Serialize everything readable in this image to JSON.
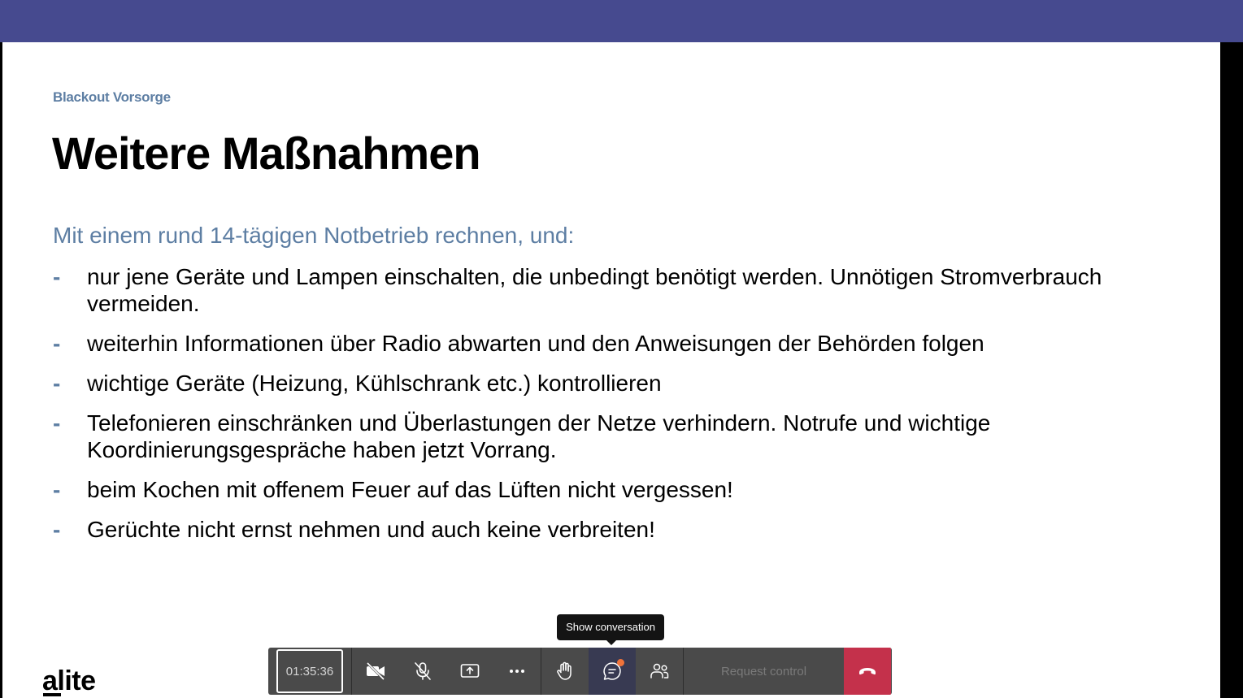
{
  "slide": {
    "kicker": "Blackout Vorsorge",
    "title": "Weitere Maßnahmen",
    "intro": "Mit einem rund 14-tägigen Notbetrieb rechnen, und:",
    "bullet_marker": "-",
    "bullets": [
      "nur jene Geräte und Lampen einschalten, die unbedingt benötigt werden. Unnötigen Stromverbrauch vermeiden.",
      "weiterhin Informationen über Radio abwarten und den Anweisungen der Behörden folgen",
      "wichtige Geräte (Heizung, Kühlschrank etc.) kontrollieren",
      "Telefonieren einschränken und Überlastungen der Netze verhindern. Notrufe und wichtige Koordinierungsgespräche haben jetzt Vorrang.",
      "beim Kochen mit offenem Feuer auf das Lüften nicht vergessen!",
      "Gerüchte nicht ernst nehmen und auch keine verbreiten!"
    ],
    "logo": "alite"
  },
  "tooltip": {
    "text": "Show conversation"
  },
  "controlbar": {
    "timer": "01:35:36",
    "request_control": "Request control",
    "buttons": [
      "camera-off-icon",
      "mic-off-icon",
      "share-screen-icon",
      "more-options-icon",
      "raise-hand-icon",
      "chat-icon",
      "participants-icon",
      "hang-up-icon"
    ]
  },
  "colors": {
    "topbar": "#464a8f",
    "accent_blue": "#5d7ea3",
    "hangup": "#c4314b",
    "notification": "#f0733a"
  }
}
